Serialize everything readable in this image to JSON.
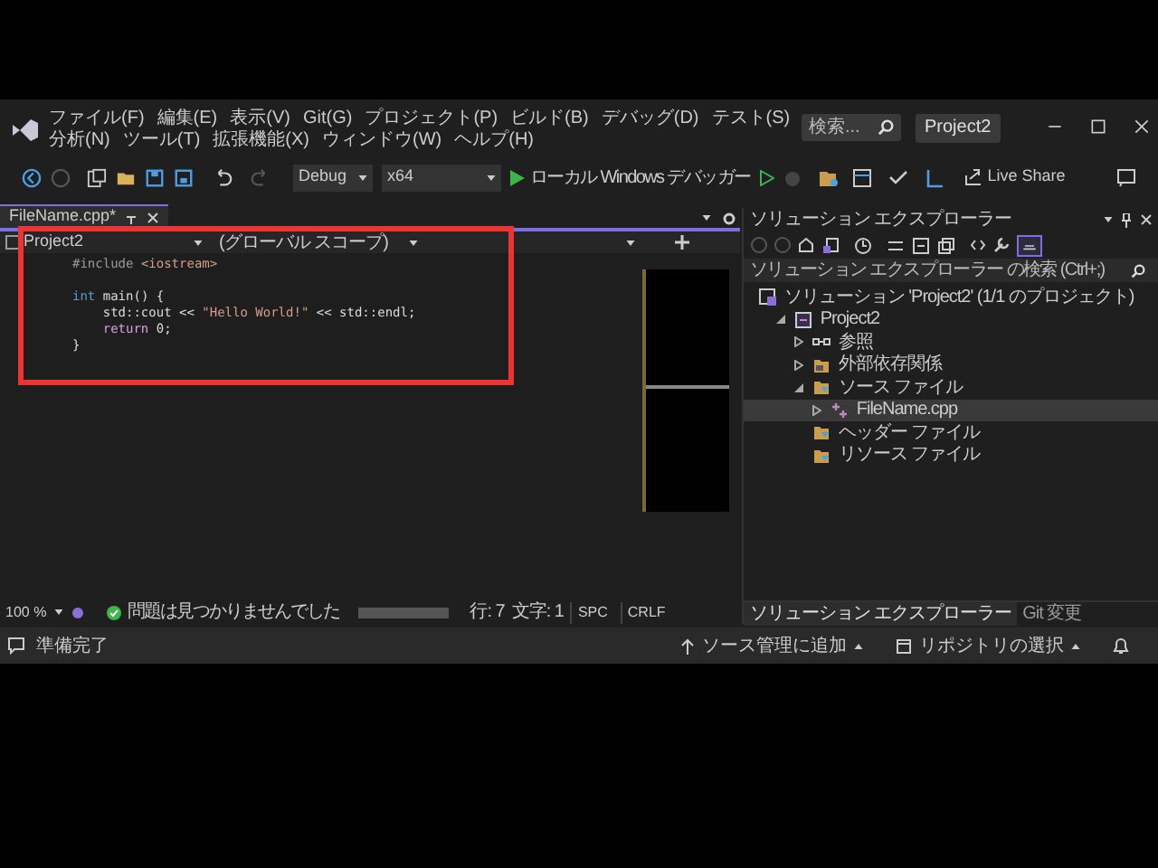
{
  "menu": [
    "ファイル(F)",
    "編集(E)",
    "表示(V)",
    "Git(G)",
    "プロジェクト(P)",
    "ビルド(B)",
    "デバッグ(D)",
    "テスト(S)",
    "分析(N)",
    "ツール(T)",
    "拡張機能(X)",
    "ウィンドウ(W)",
    "ヘルプ(H)"
  ],
  "title_search": {
    "placeholder": "検索..."
  },
  "solution_badge": "Project2",
  "toolbar": {
    "configuration": "Debug",
    "platform": "x64",
    "debugger": "ローカル Windows デバッガー",
    "live_share": "Live Share"
  },
  "editor": {
    "tab": {
      "label": "FileName.cpp*",
      "selected": true
    },
    "nav": [
      "Project2",
      "(グローバル スコープ)"
    ],
    "lines": [
      {
        "kind": "code",
        "tokens": [
          {
            "kind": "preprocessor",
            "text": "#include "
          },
          {
            "kind": "include",
            "text": "<iostream>"
          }
        ]
      },
      {
        "kind": "blank"
      },
      {
        "kind": "code",
        "tokens": [
          {
            "kind": "keyword",
            "text": "int"
          },
          {
            "kind": "plain",
            "text": " main() {"
          }
        ]
      },
      {
        "kind": "code",
        "tokens": [
          {
            "kind": "plain",
            "text": "    std::cout << "
          },
          {
            "kind": "string",
            "text": "\"Hello World!\""
          },
          {
            "kind": "plain",
            "text": " << std::endl;"
          }
        ]
      },
      {
        "kind": "code",
        "tokens": [
          {
            "kind": "control",
            "text": "    return"
          },
          {
            "kind": "plain",
            "text": " 0;"
          }
        ]
      },
      {
        "kind": "code",
        "tokens": [
          {
            "kind": "plain",
            "text": "}"
          }
        ]
      },
      {
        "kind": "blank"
      }
    ],
    "status": {
      "zoom": "100 %",
      "issues": "問題は見つかりませんでした",
      "line": "行: 7",
      "column": "文字: 1",
      "whitespace": "SPC",
      "line_ending": "CRLF"
    }
  },
  "solution_explorer": {
    "title": "ソリューション エクスプローラー",
    "search": {
      "placeholder": "ソリューション エクスプローラー の検索 (Ctrl+;)"
    },
    "tree": [
      {
        "kind": "solution",
        "label": "ソリューション 'Project2' (1/1 のプロジェクト)",
        "selected": false,
        "children": [
          {
            "kind": "project",
            "label": "Project2",
            "expanded": true,
            "selected": false,
            "children": [
              {
                "kind": "references",
                "label": "参照",
                "expanded": false,
                "selected": false
              },
              {
                "kind": "external",
                "label": "外部依存関係",
                "expanded": false,
                "selected": false
              },
              {
                "kind": "folder",
                "label": "ソース ファイル",
                "expanded": true,
                "selected": false,
                "children": [
                  {
                    "kind": "file",
                    "label": "FileName.cpp",
                    "expanded": false,
                    "selected": true
                  }
                ]
              },
              {
                "kind": "folder",
                "label": "ヘッダー ファイル",
                "selected": false
              },
              {
                "kind": "folder",
                "label": "リソース ファイル",
                "selected": false
              }
            ]
          }
        ]
      }
    ],
    "bottom_tabs": [
      {
        "label": "ソリューション エクスプローラー",
        "selected": true
      },
      {
        "label": "Git 変更",
        "selected": false
      }
    ]
  },
  "status_bar": {
    "message": "準備完了",
    "source_control": "ソース管理に追加",
    "repository": "リポジトリの選択"
  }
}
